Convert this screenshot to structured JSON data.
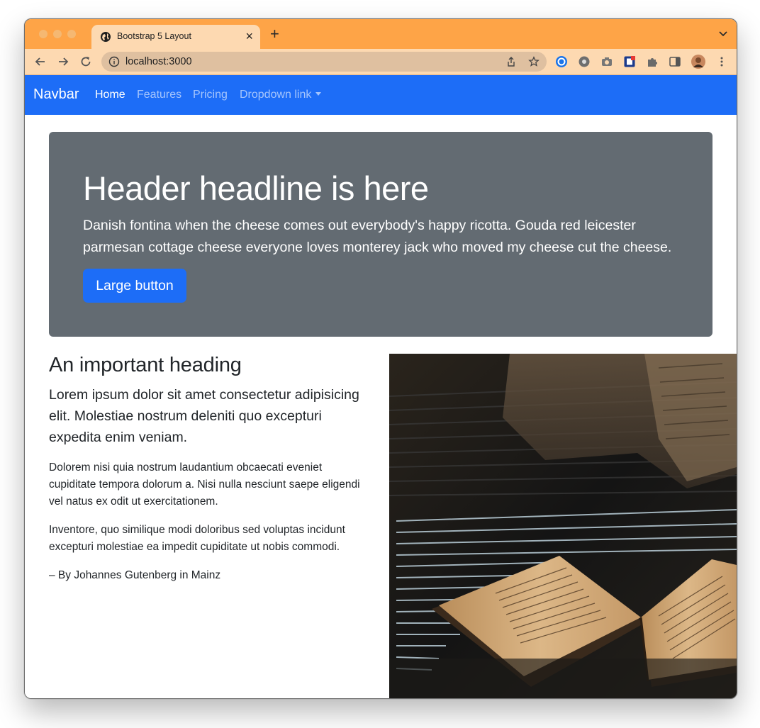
{
  "browser": {
    "tab_title": "Bootstrap 5 Layout",
    "tab_close": "×",
    "new_tab": "+",
    "url": "localhost:3000",
    "colors": {
      "tabstrip": "#fea447",
      "toolbar": "#fdd9b1"
    }
  },
  "navbar": {
    "brand": "Navbar",
    "links": [
      "Home",
      "Features",
      "Pricing",
      "Dropdown link"
    ],
    "active_link": "Home",
    "color": "#1d6df7"
  },
  "jumbotron": {
    "title": "Header headline is here",
    "lead": "Danish fontina when the cheese comes out everybody's happy ricotta. Gouda red leicester parmesan cottage cheese everyone loves monterey jack who moved my cheese cut the cheese.",
    "button_label": "Large button",
    "background": "#636b72"
  },
  "content": {
    "heading": "An important heading",
    "lead": "Lorem ipsum dolor sit amet consectetur adipisicing elit. Molestiae nostrum deleniti quo excepturi expedita enim veniam.",
    "paragraphs": [
      "Dolorem nisi quia nostrum laudantium obcaecati eveniet cupiditate tempora dolorum a. Nisi nulla nesciunt saepe eligendi vel natus ex odit ut exercitationem.",
      "Inventore, quo similique modi doloribus sed voluptas incidunt excepturi molestiae ea impedit cupiditate ut nobis commodi.",
      "– By Johannes Gutenberg in Mainz"
    ]
  },
  "icons": [
    "globe-icon",
    "back-arrow-icon",
    "forward-arrow-icon",
    "reload-icon",
    "info-icon",
    "share-icon",
    "bookmark-star-icon",
    "extension-icons",
    "puzzle-icon",
    "side-panel-icon",
    "profile-avatar",
    "more-vert-icon",
    "chevron-down-icon"
  ]
}
